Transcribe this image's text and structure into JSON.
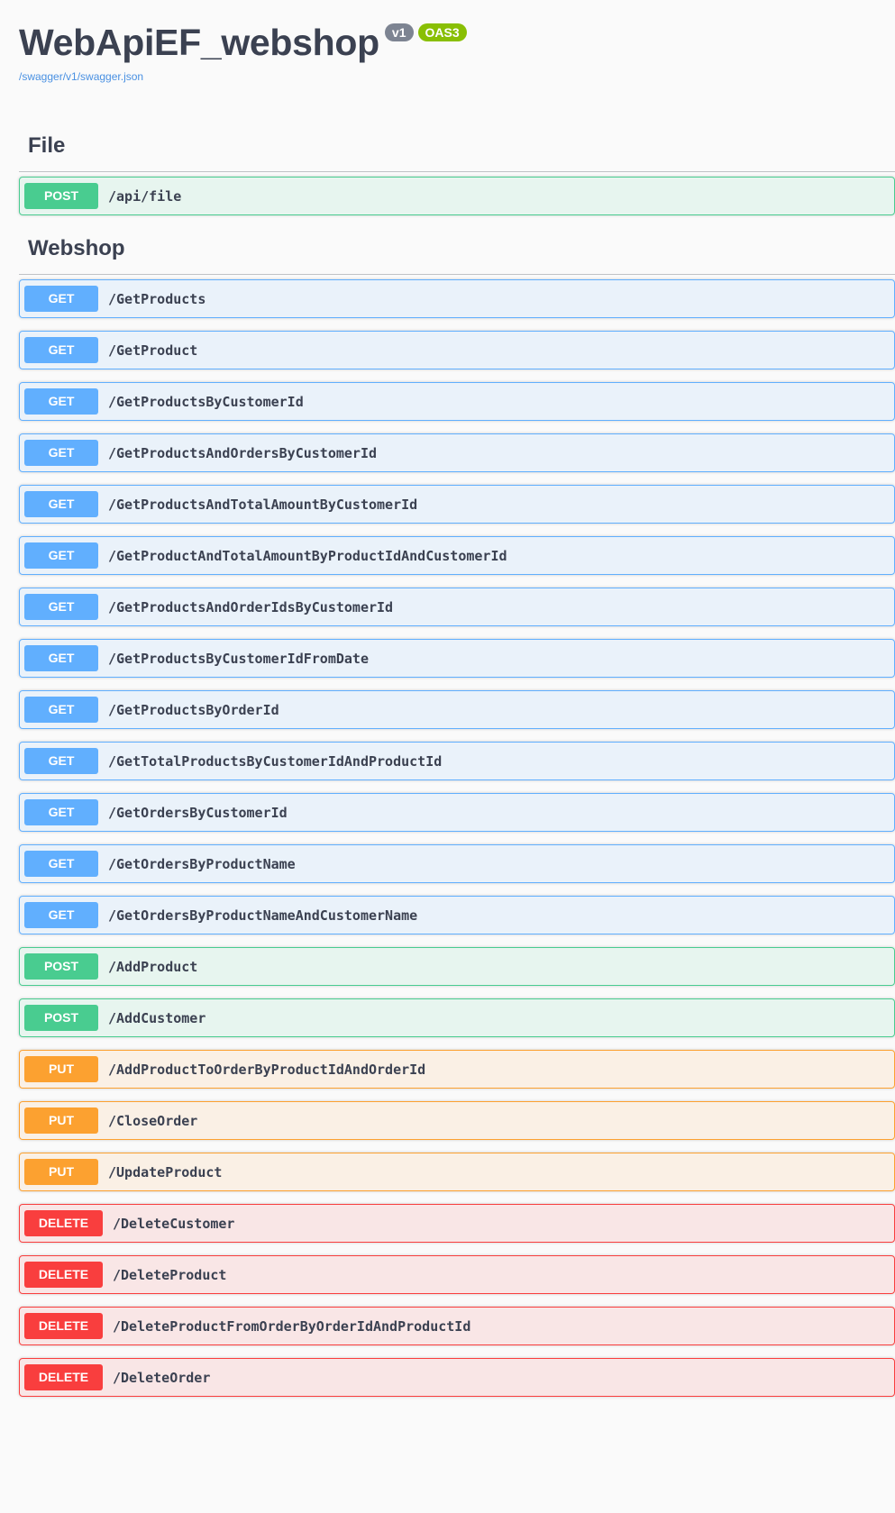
{
  "info": {
    "title": "WebApiEF_webshop",
    "version": "v1",
    "oas": "OAS3",
    "spec_url": "/swagger/v1/swagger.json"
  },
  "sections": [
    {
      "name": "File",
      "operations": [
        {
          "method": "POST",
          "path": "/api/file"
        }
      ]
    },
    {
      "name": "Webshop",
      "operations": [
        {
          "method": "GET",
          "path": "/GetProducts"
        },
        {
          "method": "GET",
          "path": "/GetProduct"
        },
        {
          "method": "GET",
          "path": "/GetProductsByCustomerId"
        },
        {
          "method": "GET",
          "path": "/GetProductsAndOrdersByCustomerId"
        },
        {
          "method": "GET",
          "path": "/GetProductsAndTotalAmountByCustomerId"
        },
        {
          "method": "GET",
          "path": "/GetProductAndTotalAmountByProductIdAndCustomerId"
        },
        {
          "method": "GET",
          "path": "/GetProductsAndOrderIdsByCustomerId"
        },
        {
          "method": "GET",
          "path": "/GetProductsByCustomerIdFromDate"
        },
        {
          "method": "GET",
          "path": "/GetProductsByOrderId"
        },
        {
          "method": "GET",
          "path": "/GetTotalProductsByCustomerIdAndProductId"
        },
        {
          "method": "GET",
          "path": "/GetOrdersByCustomerId"
        },
        {
          "method": "GET",
          "path": "/GetOrdersByProductName"
        },
        {
          "method": "GET",
          "path": "/GetOrdersByProductNameAndCustomerName"
        },
        {
          "method": "POST",
          "path": "/AddProduct"
        },
        {
          "method": "POST",
          "path": "/AddCustomer"
        },
        {
          "method": "PUT",
          "path": "/AddProductToOrderByProductIdAndOrderId"
        },
        {
          "method": "PUT",
          "path": "/CloseOrder"
        },
        {
          "method": "PUT",
          "path": "/UpdateProduct"
        },
        {
          "method": "DELETE",
          "path": "/DeleteCustomer"
        },
        {
          "method": "DELETE",
          "path": "/DeleteProduct"
        },
        {
          "method": "DELETE",
          "path": "/DeleteProductFromOrderByOrderIdAndProductId"
        },
        {
          "method": "DELETE",
          "path": "/DeleteOrder"
        }
      ]
    }
  ],
  "colors": {
    "get": "#61affe",
    "post": "#49cc90",
    "put": "#fca130",
    "delete": "#f93e3e",
    "link": "#4990e2"
  }
}
